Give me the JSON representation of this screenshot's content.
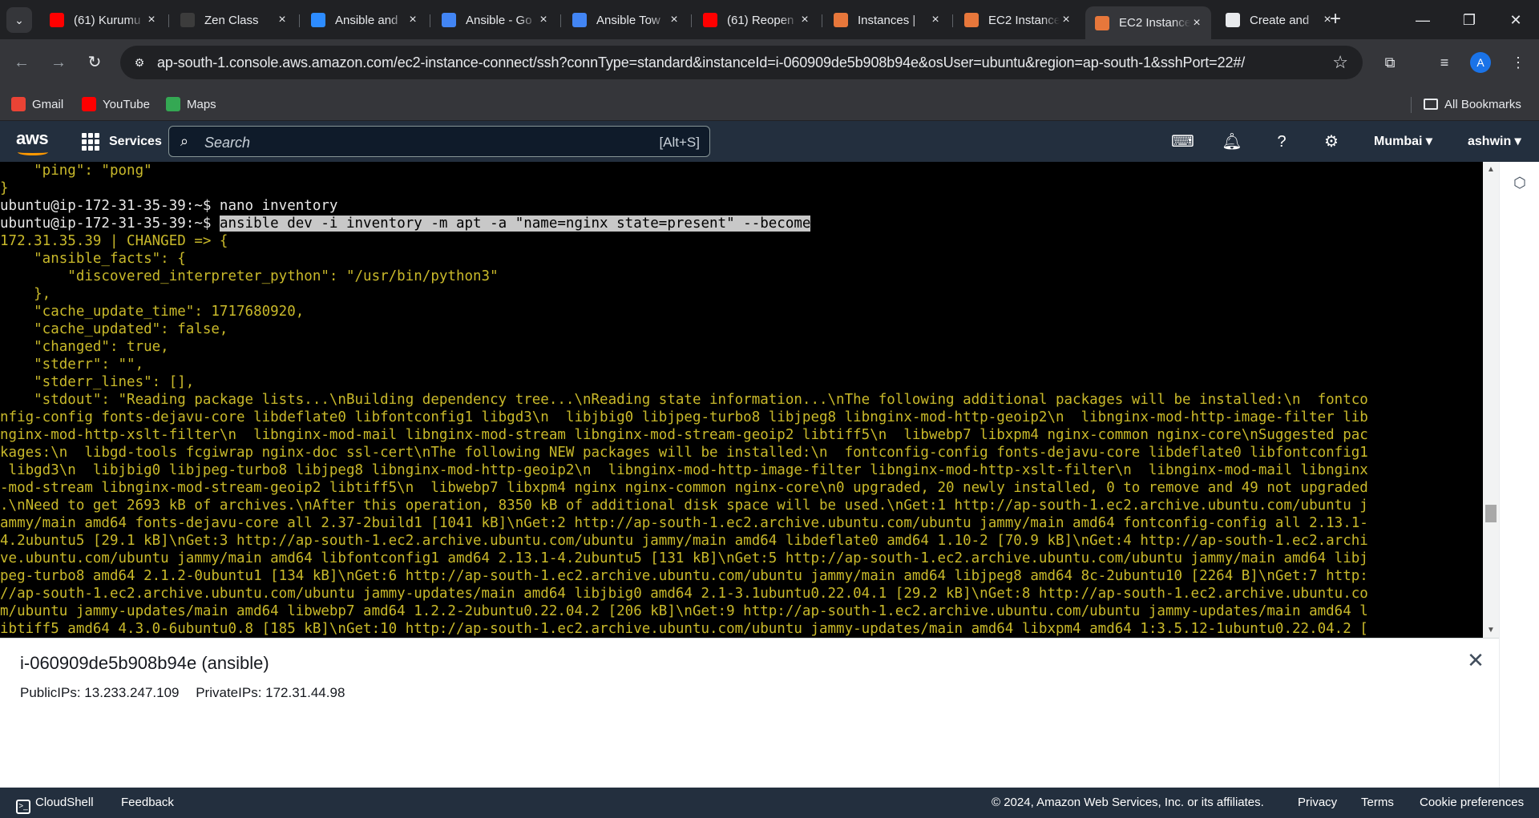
{
  "browser": {
    "tabs": [
      {
        "title": "(61) Kurumu",
        "favicon": "youtube-icon",
        "color": "#ff0000",
        "active": false
      },
      {
        "title": "Zen Class",
        "favicon": "zen-icon",
        "color": "#3c3c3c",
        "active": false
      },
      {
        "title": "Ansible and",
        "favicon": "zoom-icon",
        "color": "#2d8cff",
        "active": false
      },
      {
        "title": "Ansible - Go",
        "favicon": "docs-icon",
        "color": "#4285f4",
        "active": false
      },
      {
        "title": "Ansible Tow",
        "favicon": "docs-icon",
        "color": "#4285f4",
        "active": false
      },
      {
        "title": "(61) Reopen",
        "favicon": "youtube-icon",
        "color": "#ff0000",
        "active": false
      },
      {
        "title": "Instances |",
        "favicon": "aws-ec2-icon",
        "color": "#e7773b",
        "active": false
      },
      {
        "title": "EC2 Instance",
        "favicon": "aws-ec2-icon",
        "color": "#e7773b",
        "active": false
      },
      {
        "title": "EC2 Instance",
        "favicon": "aws-ec2-icon",
        "color": "#e7773b",
        "active": true
      },
      {
        "title": "Create and",
        "favicon": "chatgpt-icon",
        "color": "#e8eaed",
        "active": false
      }
    ],
    "url": "ap-south-1.console.aws.amazon.com/ec2-instance-connect/ssh?connType=standard&instanceId=i-060909de5b908b94e&osUser=ubuntu&region=ap-south-1&sshPort=22#/",
    "bookmarks": [
      {
        "label": "Gmail",
        "icon": "gmail-icon",
        "color": "#ea4335"
      },
      {
        "label": "YouTube",
        "icon": "youtube-icon",
        "color": "#ff0000"
      },
      {
        "label": "Maps",
        "icon": "maps-icon",
        "color": "#34a853"
      }
    ],
    "all_bookmarks": "All Bookmarks",
    "avatar_letter": "A"
  },
  "aws": {
    "logo": "aws",
    "services": "Services",
    "search_placeholder": "Search",
    "search_shortcut": "[Alt+S]",
    "region": "Mumbai ▾",
    "user": "ashwin ▾"
  },
  "terminal": {
    "lines": [
      {
        "text": "    \"ping\": \"pong\"",
        "color": "yellow"
      },
      {
        "text": "}",
        "color": "yellow"
      },
      {
        "text": "ubuntu@ip-172-31-35-39:~$ nano inventory",
        "color": "white"
      },
      {
        "prompt": "ubuntu@ip-172-31-35-39:~$ ",
        "text": "ansible dev -i inventory -m apt -a \"name=nginx state=present\" --become",
        "color": "white",
        "highlight": true
      },
      {
        "text": "172.31.35.39 | CHANGED => {",
        "color": "yellow"
      },
      {
        "text": "    \"ansible_facts\": {",
        "color": "yellow"
      },
      {
        "text": "        \"discovered_interpreter_python\": \"/usr/bin/python3\"",
        "color": "yellow"
      },
      {
        "text": "    },",
        "color": "yellow"
      },
      {
        "text": "    \"cache_update_time\": 1717680920,",
        "color": "yellow"
      },
      {
        "text": "    \"cache_updated\": false,",
        "color": "yellow"
      },
      {
        "text": "    \"changed\": true,",
        "color": "yellow"
      },
      {
        "text": "    \"stderr\": \"\",",
        "color": "yellow"
      },
      {
        "text": "    \"stderr_lines\": [],",
        "color": "yellow"
      },
      {
        "text": "    \"stdout\": \"Reading package lists...\\nBuilding dependency tree...\\nReading state information...\\nThe following additional packages will be installed:\\n  fontco",
        "color": "yellow"
      },
      {
        "text": "nfig-config fonts-dejavu-core libdeflate0 libfontconfig1 libgd3\\n  libjbig0 libjpeg-turbo8 libjpeg8 libnginx-mod-http-geoip2\\n  libnginx-mod-http-image-filter lib",
        "color": "yellow"
      },
      {
        "text": "nginx-mod-http-xslt-filter\\n  libnginx-mod-mail libnginx-mod-stream libnginx-mod-stream-geoip2 libtiff5\\n  libwebp7 libxpm4 nginx-common nginx-core\\nSuggested pac",
        "color": "yellow"
      },
      {
        "text": "kages:\\n  libgd-tools fcgiwrap nginx-doc ssl-cert\\nThe following NEW packages will be installed:\\n  fontconfig-config fonts-dejavu-core libdeflate0 libfontconfig1",
        "color": "yellow"
      },
      {
        "text": " libgd3\\n  libjbig0 libjpeg-turbo8 libjpeg8 libnginx-mod-http-geoip2\\n  libnginx-mod-http-image-filter libnginx-mod-http-xslt-filter\\n  libnginx-mod-mail libnginx",
        "color": "yellow"
      },
      {
        "text": "-mod-stream libnginx-mod-stream-geoip2 libtiff5\\n  libwebp7 libxpm4 nginx nginx-common nginx-core\\n0 upgraded, 20 newly installed, 0 to remove and 49 not upgraded",
        "color": "yellow"
      },
      {
        "text": ".\\nNeed to get 2693 kB of archives.\\nAfter this operation, 8350 kB of additional disk space will be used.\\nGet:1 http://ap-south-1.ec2.archive.ubuntu.com/ubuntu j",
        "color": "yellow"
      },
      {
        "text": "ammy/main amd64 fonts-dejavu-core all 2.37-2build1 [1041 kB]\\nGet:2 http://ap-south-1.ec2.archive.ubuntu.com/ubuntu jammy/main amd64 fontconfig-config all 2.13.1-",
        "color": "yellow"
      },
      {
        "text": "4.2ubuntu5 [29.1 kB]\\nGet:3 http://ap-south-1.ec2.archive.ubuntu.com/ubuntu jammy/main amd64 libdeflate0 amd64 1.10-2 [70.9 kB]\\nGet:4 http://ap-south-1.ec2.archi",
        "color": "yellow"
      },
      {
        "text": "ve.ubuntu.com/ubuntu jammy/main amd64 libfontconfig1 amd64 2.13.1-4.2ubuntu5 [131 kB]\\nGet:5 http://ap-south-1.ec2.archive.ubuntu.com/ubuntu jammy/main amd64 libj",
        "color": "yellow"
      },
      {
        "text": "peg-turbo8 amd64 2.1.2-0ubuntu1 [134 kB]\\nGet:6 http://ap-south-1.ec2.archive.ubuntu.com/ubuntu jammy/main amd64 libjpeg8 amd64 8c-2ubuntu10 [2264 B]\\nGet:7 http:",
        "color": "yellow"
      },
      {
        "text": "//ap-south-1.ec2.archive.ubuntu.com/ubuntu jammy-updates/main amd64 libjbig0 amd64 2.1-3.1ubuntu0.22.04.1 [29.2 kB]\\nGet:8 http://ap-south-1.ec2.archive.ubuntu.co",
        "color": "yellow"
      },
      {
        "text": "m/ubuntu jammy-updates/main amd64 libwebp7 amd64 1.2.2-2ubuntu0.22.04.2 [206 kB]\\nGet:9 http://ap-south-1.ec2.archive.ubuntu.com/ubuntu jammy-updates/main amd64 l",
        "color": "yellow"
      },
      {
        "text": "ibtiff5 amd64 4.3.0-6ubuntu0.8 [185 kB]\\nGet:10 http://ap-south-1.ec2.archive.ubuntu.com/ubuntu jammy-updates/main amd64 libxpm4 amd64 1:3.5.12-1ubuntu0.22.04.2 [",
        "color": "yellow"
      }
    ],
    "colors": {
      "yellow": "#c9b92a",
      "white": "#e8e8e8",
      "highlight": "#c8c8c8"
    }
  },
  "instance_panel": {
    "title": "i-060909de5b908b94e (ansible)",
    "public_ips": "PublicIPs: 13.233.247.109",
    "private_ips": "PrivateIPs: 172.31.44.98"
  },
  "footer": {
    "cloudshell": "CloudShell",
    "feedback": "Feedback",
    "copyright": "© 2024, Amazon Web Services, Inc. or its affiliates.",
    "privacy": "Privacy",
    "terms": "Terms",
    "cookies": "Cookie preferences"
  }
}
